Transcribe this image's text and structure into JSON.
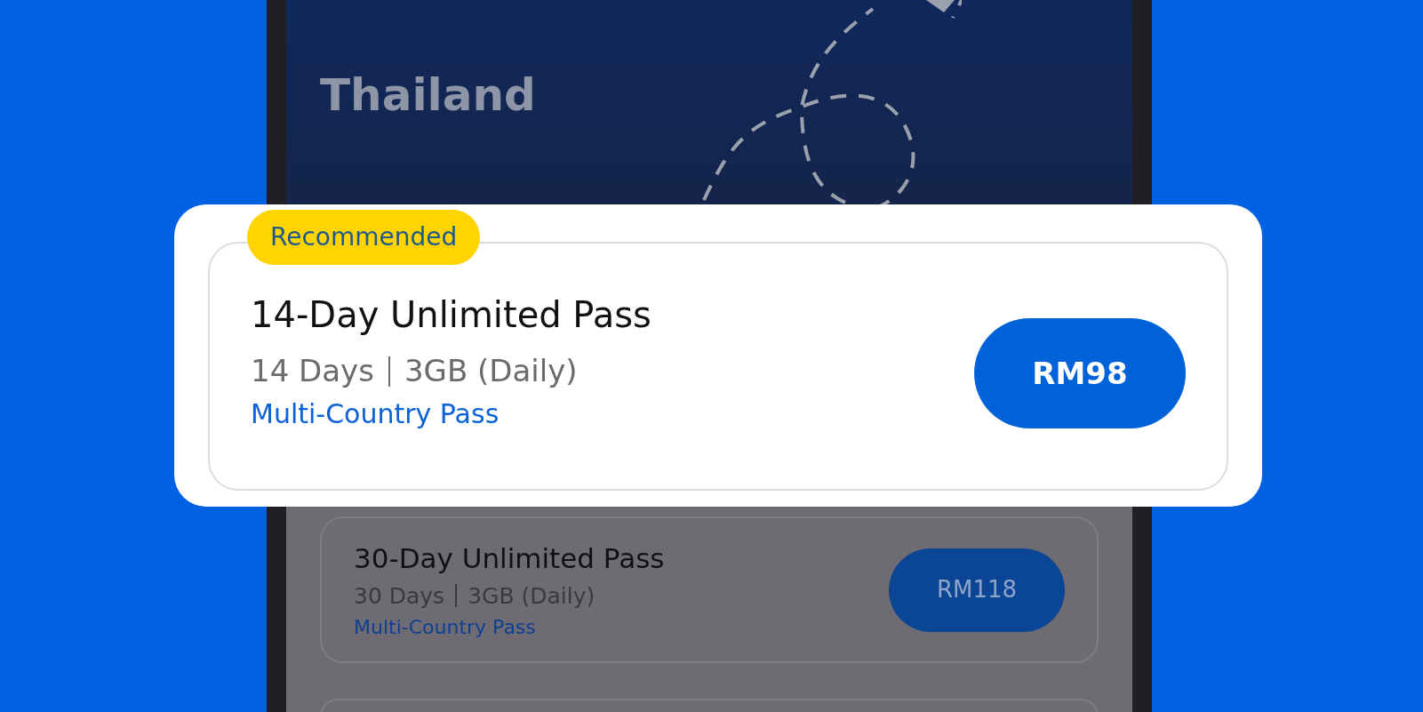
{
  "header": {
    "title": "Thailand"
  },
  "featured": {
    "badge": "Recommended",
    "title": "14-Day Unlimited Pass",
    "details": [
      "14 Days",
      "3GB (Daily)"
    ],
    "tag": "Multi-Country Pass",
    "price": "RM98"
  },
  "plans": [
    {
      "title": "30-Day Unlimited Pass",
      "details": [
        "30 Days",
        "3GB (Daily)"
      ],
      "tag": "Multi-Country Pass",
      "price": "RM118"
    }
  ]
}
